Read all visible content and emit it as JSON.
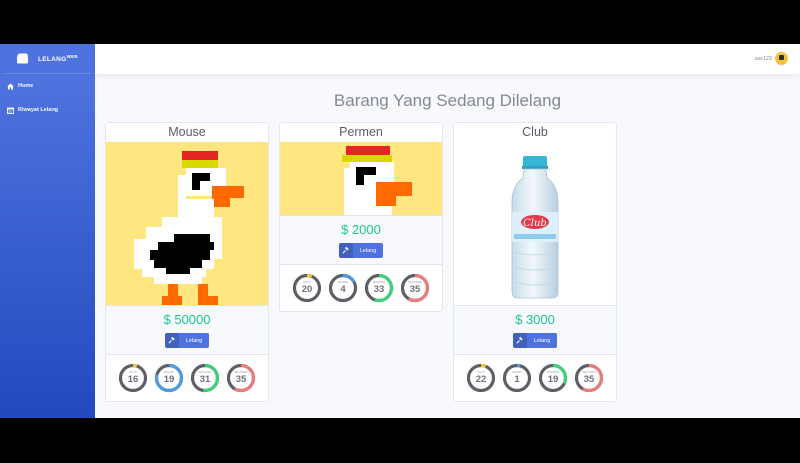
{
  "brand": {
    "name": "LELANG",
    "sup": "WEB",
    "icon": "gavel-box-icon"
  },
  "sidebar": {
    "items": [
      {
        "label": "Home",
        "icon": "home-icon"
      },
      {
        "label": "Riwayat Lelang",
        "icon": "calendar-icon"
      }
    ]
  },
  "topbar": {
    "username": "sss123",
    "avatar": "user-avatar"
  },
  "main": {
    "title": "Barang Yang Sedang Dilelang"
  },
  "items": [
    {
      "name": "Mouse",
      "price": "$ 50000",
      "button": "Lelang",
      "image": "pixel-duck",
      "countdown": [
        {
          "value": "16",
          "unit": "DAYS",
          "level": 0.05,
          "color": "#f6c23e"
        },
        {
          "value": "19",
          "unit": "HOURS",
          "level": 0.79,
          "color": "#4e9ae0"
        },
        {
          "value": "31",
          "unit": "MINUTES",
          "level": 0.52,
          "color": "#3fd17a"
        },
        {
          "value": "35",
          "unit": "SECONDS",
          "level": 0.58,
          "color": "#ea7c7c"
        }
      ]
    },
    {
      "name": "Permen",
      "price": "$ 2000",
      "button": "Lelang",
      "image": "pixel-duck-cropped",
      "countdown": [
        {
          "value": "20",
          "unit": "DAYS",
          "level": 0.06,
          "color": "#f6c23e"
        },
        {
          "value": "4",
          "unit": "HOURS",
          "level": 0.17,
          "color": "#4e9ae0"
        },
        {
          "value": "33",
          "unit": "MINUTES",
          "level": 0.55,
          "color": "#3fd17a"
        },
        {
          "value": "35",
          "unit": "SECONDS",
          "level": 0.58,
          "color": "#ea7c7c"
        }
      ]
    },
    {
      "name": "Club",
      "price": "$ 3000",
      "button": "Lelang",
      "image": "water-bottle",
      "countdown": [
        {
          "value": "22",
          "unit": "DAYS",
          "level": 0.06,
          "color": "#f6c23e"
        },
        {
          "value": "1",
          "unit": "HOURS",
          "level": 0.04,
          "color": "#4e9ae0"
        },
        {
          "value": "19",
          "unit": "MINUTES",
          "level": 0.32,
          "color": "#3fd17a"
        },
        {
          "value": "35",
          "unit": "SECONDS",
          "level": 0.58,
          "color": "#ea7c7c"
        }
      ]
    }
  ],
  "colors": {
    "accent": "#4e73df",
    "price": "#1cc88a",
    "title": "#858796"
  }
}
